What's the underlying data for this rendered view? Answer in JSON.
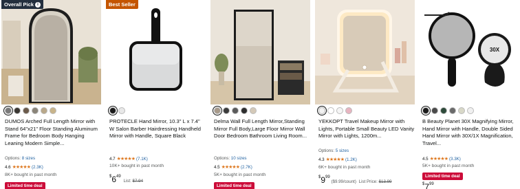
{
  "products": [
    {
      "badge": "Overall Pick",
      "badge_info_icon": "info-icon",
      "swatches": [
        "#7a7a7a",
        "#3a3632",
        "#6b5a4a",
        "#8a8478",
        "#b9a88a",
        "#c8b48a"
      ],
      "title": "DUMOS Arched Full Length Mirror with Stand 64\"x21\" Floor Standing Aluminum Frame for Bedroom Body Hanging Leaning Modern Simple...",
      "options_label": "Options:",
      "options_link": "8 sizes",
      "rating": "4.6",
      "stars": "★★★★★",
      "rating_count": "(2.3K)",
      "bought": "8K+ bought in past month",
      "deal": "Limited time deal"
    },
    {
      "badge": "Best Seller",
      "swatches": [
        "#1a1a1a",
        "#e8e8e8"
      ],
      "title": "PROTECLE Hand Mirror, 10.3\" L x 7.4\" W Salon Barber Hairdressing Handheld Mirror with Handle, Square Black",
      "rating": "4.7",
      "stars": "★★★★★",
      "rating_count": "(7.1K)",
      "bought": "10K+ bought in past month",
      "price_symbol": "$",
      "price_whole": "6",
      "price_fraction": "49",
      "list_label": "List:",
      "list_price": "$7.94"
    },
    {
      "swatches": [
        "#a89a8a",
        "#3a3a3a",
        "#5a5a5a",
        "#2d2d2d",
        "#d4c9b8"
      ],
      "title": "Delma Wall Full Length Mirror,Standing Mirror Full Body,Large Floor Mirror Wall Door Bedroom Bathroom Living Room...",
      "options_label": "Options:",
      "options_link": "10 sizes",
      "rating": "4.5",
      "stars": "★★★★★",
      "rating_count": "(2.7K)",
      "bought": "5K+ bought in past month",
      "deal": "Limited time deal"
    },
    {
      "swatches": [
        "#f2f2f2",
        "#ffffff",
        "#f5f5f5",
        "#e8b4c0"
      ],
      "title": "YEKKOPT Travel Makeup Mirror with Lights, Portable Small Beauty LED Vanity Mirror with Lights, 1200m...",
      "options_label": "Options:",
      "options_link": "5 sizes",
      "rating": "4.3",
      "stars": "★★★★★",
      "rating_count": "(1.2K)",
      "bought": "6K+ bought in past month",
      "price_symbol": "$",
      "price_whole": "9",
      "price_fraction": "99",
      "unit_price": "($9.99/count)",
      "list_label": "List Price:",
      "list_price": "$13.99"
    },
    {
      "swatches": [
        "#1a1a1a",
        "#4a4a4a",
        "#2d4a3a",
        "#6a6a6a",
        "#d8d8c8",
        "#f0f0f0"
      ],
      "title": "B Beauty Planet 30X Magnifying Mirror, Hand Mirror with Handle, Double Sided Hand Mirror with 30X/1X Magnification, Travel...",
      "magnification_label": "30X",
      "rating": "4.5",
      "stars": "★★★★★",
      "rating_count": "(3.3K)",
      "bought": "5K+ bought in past month",
      "deal": "Limited time deal",
      "price_symbol": "$",
      "price_whole": "7",
      "price_fraction": "99"
    }
  ]
}
